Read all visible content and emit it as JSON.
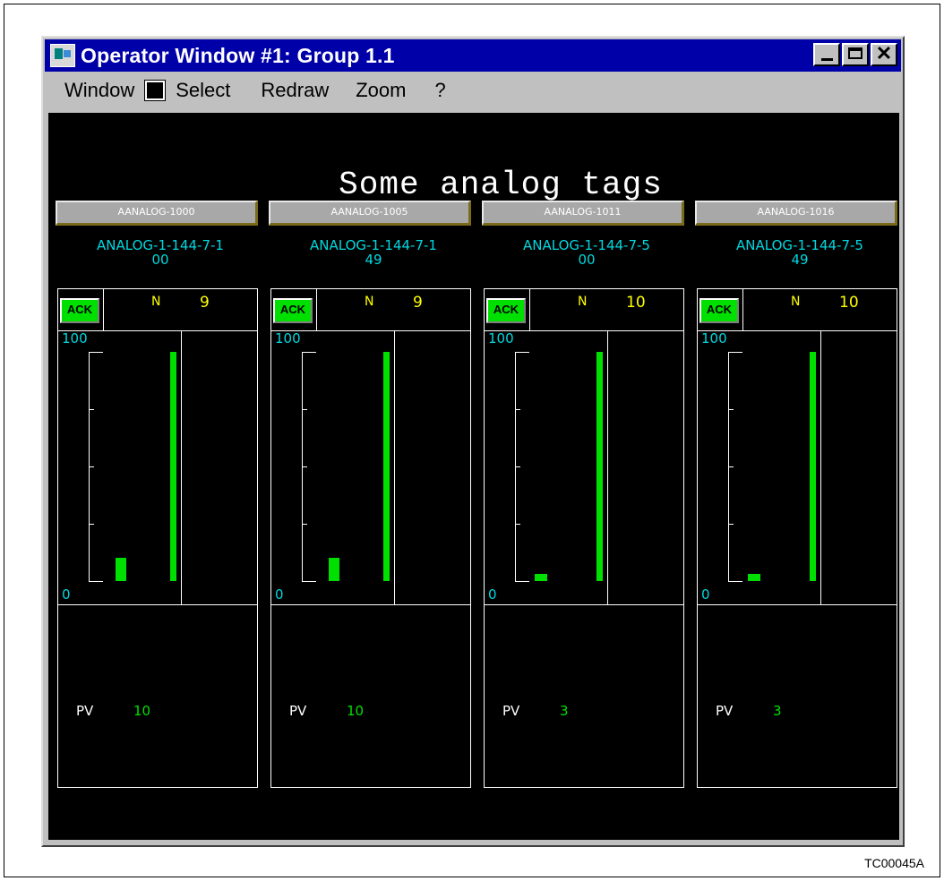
{
  "window": {
    "title": "Operator Window #1: Group 1.1",
    "close_glyph": "✕",
    "icon": "app-icon"
  },
  "menu": {
    "items": [
      "Window",
      "Select",
      "Redraw",
      "Zoom",
      "?"
    ],
    "swatch_color": "#000000"
  },
  "display": {
    "heading": "Some analog tags",
    "panels": [
      {
        "tag": "AANALOG-1000",
        "desc_line1": "ANALOG-1-144-7-1",
        "desc_line2": "00",
        "ack": "ACK",
        "mode": "N",
        "count": "9",
        "scale_hi": "100",
        "scale_lo": "0",
        "pv_label": "PV",
        "pv": "10",
        "pv_fraction": 0.1,
        "sp_fraction": 1.0
      },
      {
        "tag": "AANALOG-1005",
        "desc_line1": "ANALOG-1-144-7-1",
        "desc_line2": "49",
        "ack": "ACK",
        "mode": "N",
        "count": "9",
        "scale_hi": "100",
        "scale_lo": "0",
        "pv_label": "PV",
        "pv": "10",
        "pv_fraction": 0.1,
        "sp_fraction": 1.0
      },
      {
        "tag": "AANALOG-1011",
        "desc_line1": "ANALOG-1-144-7-5",
        "desc_line2": "00",
        "ack": "ACK",
        "mode": "N",
        "count": "10",
        "scale_hi": "100",
        "scale_lo": "0",
        "pv_label": "PV",
        "pv": "3",
        "pv_fraction": 0.03,
        "sp_fraction": 1.0
      },
      {
        "tag": "AANALOG-1016",
        "desc_line1": "ANALOG-1-144-7-5",
        "desc_line2": "49",
        "ack": "ACK",
        "mode": "N",
        "count": "10",
        "scale_hi": "100",
        "scale_lo": "0",
        "pv_label": "PV",
        "pv": "3",
        "pv_fraction": 0.03,
        "sp_fraction": 1.0
      }
    ]
  },
  "figure_label": "TC00045A"
}
